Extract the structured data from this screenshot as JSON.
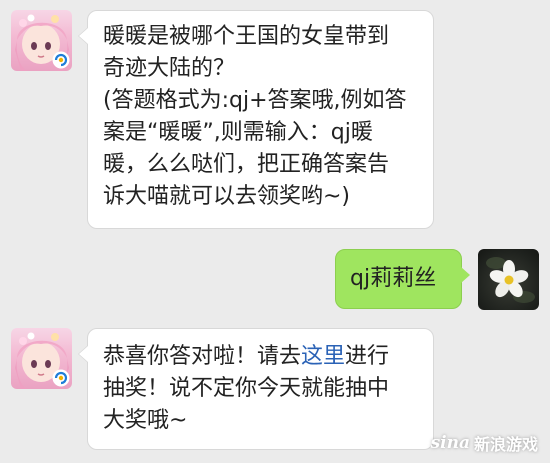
{
  "messages": {
    "first": {
      "text": "暖暖是被哪个王国的女皇带到\n奇迹大陆的？\n(答题格式为:qj+答案哦,例如答\n案是“暖暖”,则需输入：qj暖\n暖，么么哒们，把正确答案告\n诉大喵就可以去领奖哟~)"
    },
    "reply": {
      "text": "qj莉莉丝"
    },
    "second": {
      "before_link": "恭喜你答对啦！请去",
      "link": "这里",
      "after_link": "进行\n抽奖！说不定你今天就能抽中\n大奖哦~"
    }
  },
  "watermark": {
    "brand": "新浪游戏",
    "logo_text": "sina"
  },
  "colors": {
    "background": "#ebebeb",
    "bubble_left": "#ffffff",
    "bubble_right": "#9fe55f",
    "link": "#2a62b6"
  },
  "icons": {
    "bot_avatar": "anime-girl-avatar",
    "bot_badge": "qq-games-badge-icon",
    "user_avatar": "white-flower-avatar"
  }
}
